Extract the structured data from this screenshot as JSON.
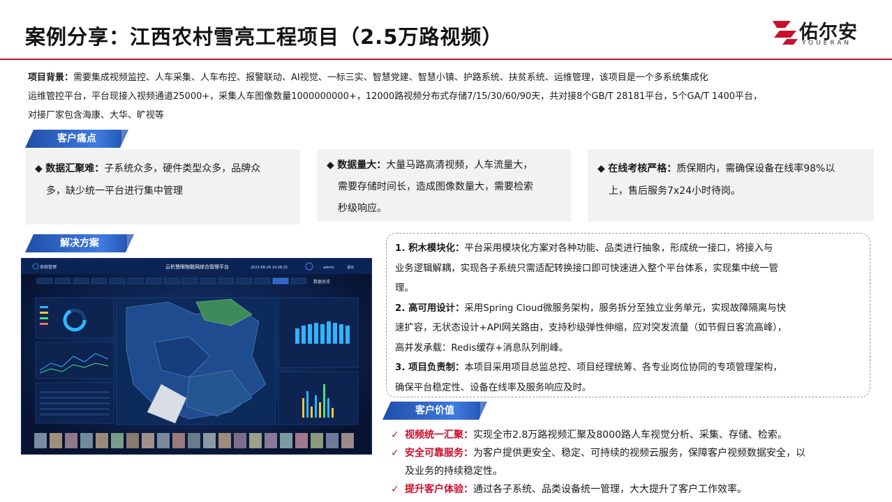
{
  "header": {
    "title": "案例分享：江西农村雪亮工程项目（2.5万路视频）",
    "logo_cn": "佑尔安",
    "logo_en": "YOUERAN"
  },
  "background": {
    "label": "项目背景：",
    "text1": "需要集成视频监控、人车采集、人车布控、报警联动、AI视觉、一标三实、智慧党建、智慧小镇、护路系统、扶贫系统、运维管理，该项目是一个多系统集成化",
    "text2": "运维管控平台，平台现接入视频通道25000+，采集人车图像数量1000000000+，12000路视频分布式存储7/15/30/60/90天，共对接8个GB/T 28181平台，5个GA/T 1400平台，",
    "text3": "对接厂家包含海康、大华、旷视等"
  },
  "pain_points": {
    "ribbon": "客户痛点",
    "items": [
      {
        "label": "数据汇聚难：",
        "line1": "子系统众多，硬件类型众多，品牌众",
        "line2": "多，缺少统一平台进行集中管理",
        "line3": ""
      },
      {
        "label": "数据量大：",
        "line1": "大量马路高清视频，人车流量大，",
        "line2": "需要存储时间长，造成图像数量大，需要检索",
        "line3": "秒级响应。"
      },
      {
        "label": "在线考核严格：",
        "line1": "质保期内，需确保设备在线率98%以",
        "line2": "上，售后服务7x24小时待岗。",
        "line3": ""
      }
    ]
  },
  "solution": {
    "ribbon": "解决方案",
    "items": [
      {
        "label": "1. 积木模块化：",
        "line1": "平台采用模块化方案对各种功能、品类进行抽象，形成统一接口，将接入与",
        "line2": "业务逻辑解耦，实现各子系统只需适配转换接口即可快速进入整个平台体系，实现集中统一管",
        "line3": "理。"
      },
      {
        "label": "2. 高可用设计：",
        "line1": "采用Spring Cloud微服务架构，服务拆分至独立业务单元，实现故障隔离与快",
        "line2": "速扩容，无状态设计+API网关路由，支持秒级弹性伸缩，应对突发流量（如节假日客流高峰），",
        "line3": "高并发承载：Redis缓存+消息队列削峰。"
      },
      {
        "label": "3. 项目负责制：",
        "line1": "本项目采用项目总监总控、项目经理统筹、各专业岗位协同的专项管理架构，",
        "line2": "确保平台稳定性、设备在线率及服务响应及时。",
        "line3": ""
      }
    ]
  },
  "dashboard": {
    "title": "云析慧眼物联网综合管理平台",
    "left_title": "系统管理",
    "datetime": "2023-08-24 14:28:25",
    "user": "admin",
    "exit": "退出",
    "nav_right": "数据总览"
  },
  "value": {
    "ribbon": "客户价值",
    "items": [
      {
        "label": "视频统一汇聚：",
        "line1": "实现全市2.8万路视频汇聚及8000路人车视觉分析、采集、存储、检索。",
        "line2": ""
      },
      {
        "label": "安全可靠服务：",
        "line1": "为客户提供更安全、稳定、可持续的视频云服务，保障客户视频数据安全，以",
        "line2": "及业务的持续稳定性。"
      },
      {
        "label": "提升客户体验：",
        "line1": "通过各子系统、品类设备统一管理，大大提升了客户工作效率。",
        "line2": ""
      }
    ]
  },
  "colors": {
    "accent_red": "#c8102e",
    "ribbon_blue": "#2f66cf",
    "dashboard_bg": "#0a1838"
  }
}
